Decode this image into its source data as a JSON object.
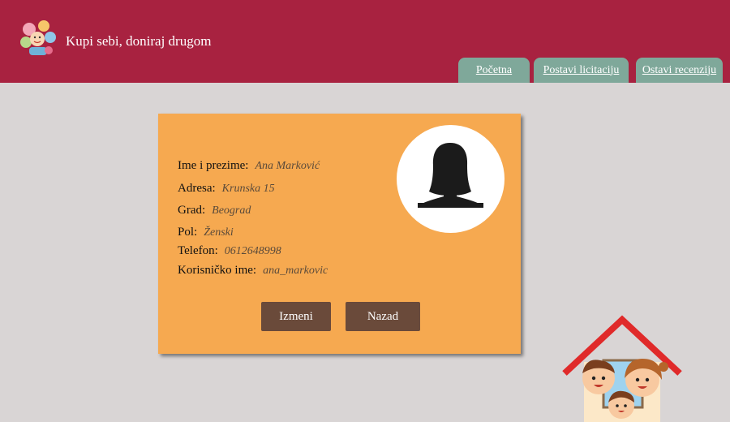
{
  "header": {
    "site_title": "Kupi sebi, doniraj drugom",
    "tabs": [
      {
        "label": "Početna"
      },
      {
        "label": "Postavi licitaciju"
      },
      {
        "label": "Ostavi recenziju"
      }
    ],
    "background_color": "#a82240",
    "tab_color": "#7fa89a"
  },
  "profile": {
    "fields": [
      {
        "label": "Ime i prezime:",
        "value": "Ana Marković"
      },
      {
        "label": "Adresa:",
        "value": "Krunska 15"
      },
      {
        "label": "Grad:",
        "value": "Beograd"
      },
      {
        "label": "Pol:",
        "value": "Ženski"
      },
      {
        "label": "Telefon:",
        "value": "0612648998"
      },
      {
        "label": "Korisničko ime:",
        "value": "ana_markovic"
      }
    ],
    "buttons": {
      "edit_label": "Izmeni",
      "back_label": "Nazad"
    },
    "card_color": "#f6a950",
    "button_color": "#6a4a3a"
  },
  "icons": {
    "logo": "children-logo",
    "avatar": "female-user-silhouette",
    "decoration": "family-house-illustration"
  }
}
